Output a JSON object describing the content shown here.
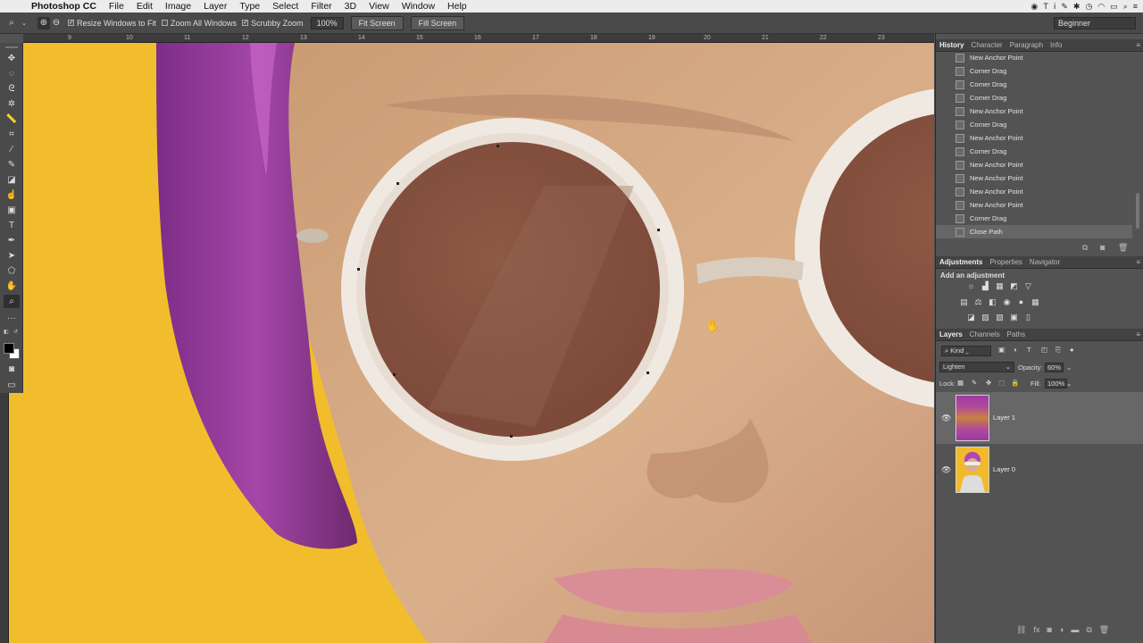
{
  "menubar": {
    "app_name": "Photoshop CC",
    "items": [
      "File",
      "Edit",
      "Image",
      "Layer",
      "Type",
      "Select",
      "Filter",
      "3D",
      "View",
      "Window",
      "Help"
    ]
  },
  "options": {
    "resize_windows": "Resize Windows to Fit",
    "zoom_all": "Zoom All Windows",
    "scrubby_zoom": "Scrubby Zoom",
    "zoom_value": "100%",
    "fit_screen": "Fit Screen",
    "fill_screen": "Fill Screen",
    "workspace": "Beginner"
  },
  "ruler": {
    "ticks": [
      "9",
      "10",
      "11",
      "12",
      "13",
      "14",
      "15",
      "16",
      "17",
      "18",
      "19",
      "20",
      "21",
      "22",
      "23"
    ]
  },
  "panels": {
    "history_tabs": [
      "History",
      "Character",
      "Paragraph",
      "Info"
    ],
    "history_items": [
      "New Anchor Point",
      "Corner Drag",
      "Corner Drag",
      "Corner Drag",
      "New Anchor Point",
      "Corner Drag",
      "New Anchor Point",
      "Corner Drag",
      "New Anchor Point",
      "New Anchor Point",
      "New Anchor Point",
      "New Anchor Point",
      "Corner Drag",
      "Close Path"
    ],
    "adjust_tabs": [
      "Adjustments",
      "Properties",
      "Navigator"
    ],
    "add_adjustment": "Add an adjustment",
    "layer_tabs": [
      "Layers",
      "Channels",
      "Paths"
    ],
    "kind": "Kind",
    "blend_mode": "Lighten",
    "opacity_label": "Opacity:",
    "opacity_value": "60%",
    "lock_label": "Lock:",
    "fill_label": "Fill:",
    "fill_value": "100%",
    "layers": [
      {
        "name": "Layer 1"
      },
      {
        "name": "Layer 0"
      }
    ]
  },
  "colors": {
    "canvas_bg": "#f2bd2c",
    "panel": "#535353",
    "accent_hair": "#9c3f9a"
  }
}
